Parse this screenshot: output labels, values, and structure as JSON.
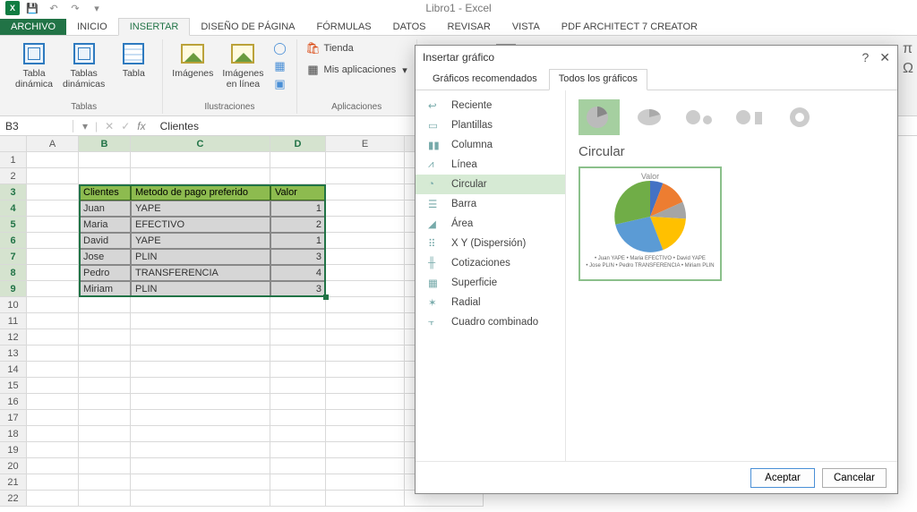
{
  "window": {
    "title": "Libro1 - Excel"
  },
  "ribbon": {
    "file": "ARCHIVO",
    "tabs": [
      "INICIO",
      "INSERTAR",
      "DISEÑO DE PÁGINA",
      "FÓRMULAS",
      "DATOS",
      "REVISAR",
      "VISTA",
      "PDF Architect 7 Creator"
    ],
    "active": "INSERTAR"
  },
  "groups": {
    "tablas": {
      "label": "Tablas",
      "items": [
        "Tabla\ndinámica",
        "Tablas\ndinámicas",
        "Tabla"
      ]
    },
    "ilustraciones": {
      "label": "Ilustraciones",
      "items": [
        "Imágenes",
        "Imágenes\nen línea"
      ]
    },
    "aplicaciones": {
      "label": "Aplicaciones",
      "tienda": "Tienda",
      "mis": "Mis aplicaciones"
    },
    "graficos": {
      "rec": "Gráficos\nrecomendados"
    }
  },
  "namebox": "B3",
  "fxvalue": "Clientes",
  "columns": [
    "A",
    "B",
    "C",
    "D",
    "E"
  ],
  "table": {
    "headers": [
      "Clientes",
      "Metodo de pago preferido",
      "Valor"
    ],
    "rows": [
      [
        "Juan",
        "YAPE",
        "1"
      ],
      [
        "Maria",
        "EFECTIVO",
        "2"
      ],
      [
        "David",
        "YAPE",
        "1"
      ],
      [
        "Jose",
        "PLIN",
        "3"
      ],
      [
        "Pedro",
        "TRANSFERENCIA",
        "4"
      ],
      [
        "Miriam",
        "PLIN",
        "3"
      ]
    ]
  },
  "dialog": {
    "title": "Insertar gráfico",
    "tabs": [
      "Gráficos recomendados",
      "Todos los gráficos"
    ],
    "activeTab": 1,
    "categories": [
      "Reciente",
      "Plantillas",
      "Columna",
      "Línea",
      "Circular",
      "Barra",
      "Área",
      "X Y (Dispersión)",
      "Cotizaciones",
      "Superficie",
      "Radial",
      "Cuadro combinado"
    ],
    "selectedCategory": "Circular",
    "chartTypeLabel": "Circular",
    "previewTitle": "Valor",
    "previewLegend": "• Juan YAPE  • Maria EFECTIVO  • David YAPE\n• Jose PLIN  • Pedro TRANSFERENCIA  • Miriam PLIN",
    "ok": "Aceptar",
    "cancel": "Cancelar"
  },
  "chart_data": {
    "type": "pie",
    "categories": [
      "Juan YAPE",
      "Maria EFECTIVO",
      "David YAPE",
      "Jose PLIN",
      "Pedro TRANSFERENCIA",
      "Miriam PLIN"
    ],
    "values": [
      1,
      2,
      1,
      3,
      4,
      3
    ],
    "title": "Valor"
  }
}
